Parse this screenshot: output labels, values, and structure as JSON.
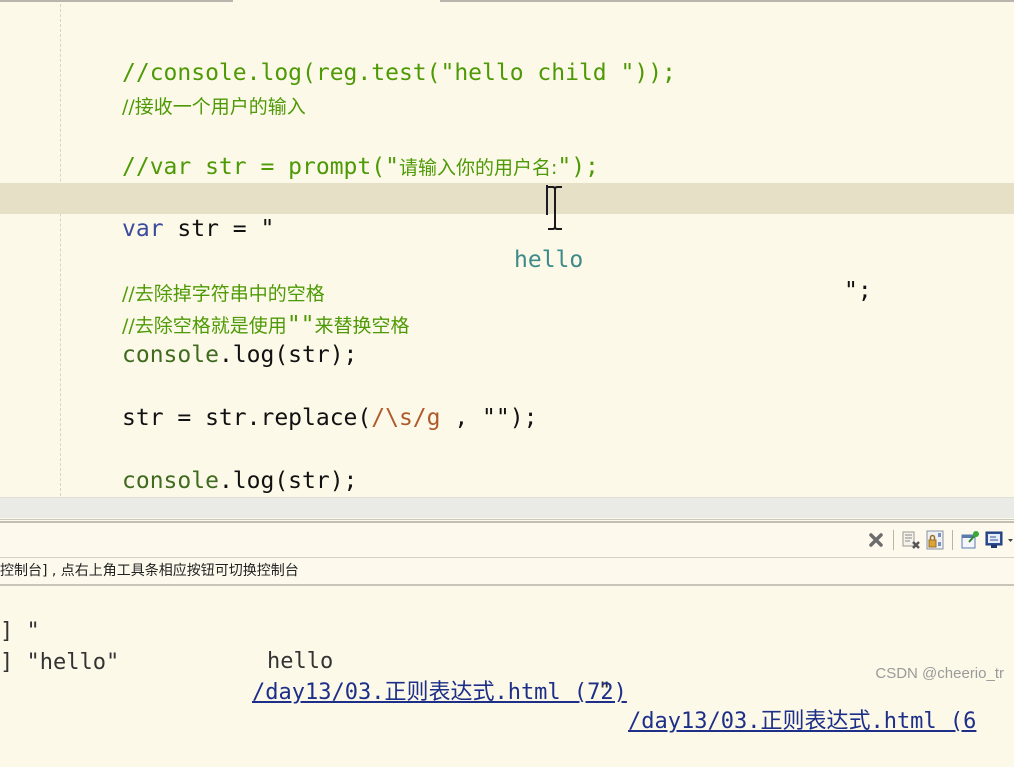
{
  "editor": {
    "lines": [
      {
        "text": "//console.log(reg.test(\"hello child \"));"
      },
      {
        "text": "//接收一个用户的输入"
      },
      {
        "text_prefix": "//var str = prompt(\"",
        "text_cjk": "请输入你的用户名:",
        "text_suffix": "\");"
      },
      {
        "kw": "var",
        "id": " str = \"",
        "value": "hello",
        "end": "\";",
        "current": true
      },
      {
        "text": "//去除掉字符串中的空格"
      },
      {
        "text_prefix": "//去除空格就是使用",
        "text_quote": "\"\"",
        "text_suffix": "来替换空格"
      },
      {
        "fn": "console",
        "rest": ".log(str);"
      },
      {
        "id": "str = str.replace(",
        "regex": "/\\s/g",
        "rest": " , \"\");"
      },
      {
        "fn": "console",
        "rest": ".log(str);"
      }
    ]
  },
  "console": {
    "toolbar_icons": [
      "clear-console-icon",
      "remove-launch-icon",
      "scroll-lock-icon",
      "pin-console-icon",
      "display-console-icon"
    ],
    "hint": "控制台] , 点右上角工具条相应按钮可切换控制台",
    "output": [
      {
        "prefix": "] \"",
        "value": "hello",
        "suffix": "\"",
        "link": "/day13/03.正则表达式.html (6"
      },
      {
        "prefix": "] \"hello\"",
        "link": "/day13/03.正则表达式.html (72)"
      }
    ]
  },
  "watermark": "CSDN @cheerio_tr"
}
